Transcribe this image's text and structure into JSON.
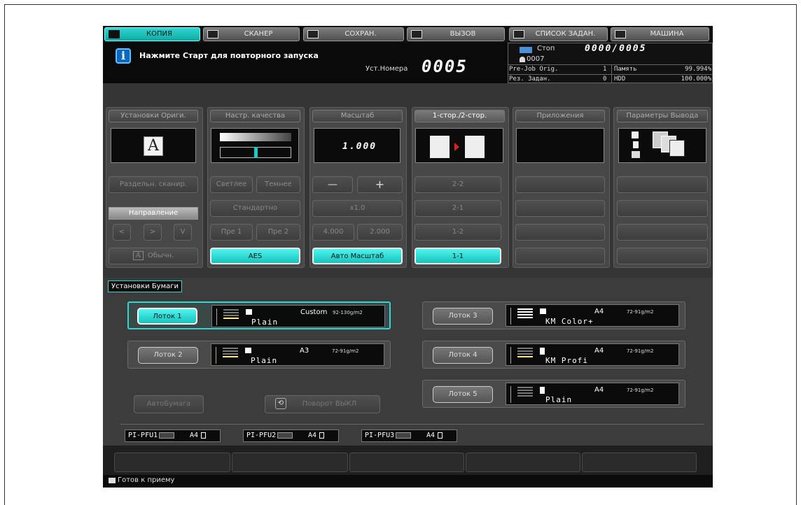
{
  "tabs": [
    {
      "label": "КОПИЯ",
      "icon": "copy-icon"
    },
    {
      "label": "СКАНЕР",
      "icon": "scanner-icon"
    },
    {
      "label": "СОХРАН.",
      "icon": "save-icon"
    },
    {
      "label": "ВЫЗОВ",
      "icon": "recall-icon"
    },
    {
      "label": "СПИСОК ЗАДАН.",
      "icon": "job-list-icon"
    },
    {
      "label": "МАШИНА",
      "icon": "machine-icon"
    }
  ],
  "header": {
    "message": "Нажмите Старт для повторного запуска",
    "set_number_label": "Уст.Номера",
    "set_number": "0005",
    "status_label": "Стоп",
    "counter": "0000/0005",
    "user_id": "0007",
    "prejob_label": "Pre-Job Orig.",
    "prejob_value": "1",
    "memory_label": "Память",
    "memory_value": "99.994%",
    "reserve_label": "Рез. Задан.",
    "reserve_value": "0",
    "hdd_label": "HDD",
    "hdd_value": "100.000%"
  },
  "panels": {
    "original": {
      "title": "Установки Ориги.",
      "separate_scan": "Раздельн. сканир.",
      "direction": "Направление",
      "normal": "Обычн.",
      "display_letter": "A"
    },
    "quality": {
      "title": "Настр. качества",
      "lighter": "Светлее",
      "darker": "Темнее",
      "standard": "Стандартно",
      "pre1": "Пре 1",
      "pre2": "Пре 2",
      "aes": "AES"
    },
    "zoom": {
      "title": "Масштаб",
      "value": "1.000",
      "minus": "—",
      "plus": "+",
      "x1": "x1.0",
      "z4": "4.000",
      "z2": "2.000",
      "auto": "Авто Масштаб"
    },
    "duplex": {
      "title": "1-стор./2-стор.",
      "o22": "2-2",
      "o21": "2-1",
      "o12": "1-2",
      "o11": "1-1"
    },
    "apps": {
      "title": "Приложения"
    },
    "output": {
      "title": "Параметры Вывода"
    }
  },
  "paper": {
    "title": "Установки Бумаги",
    "trays": [
      {
        "label": "Лоток 1",
        "size": "Custom",
        "weight": "92-130g/m2",
        "type": "Plain"
      },
      {
        "label": "Лоток 2",
        "size": "A3",
        "weight": "72-91g/m2",
        "type": "Plain"
      },
      {
        "label": "Лоток 3",
        "size": "A4",
        "weight": "72-91g/m2",
        "type": "KM Color+"
      },
      {
        "label": "Лоток 4",
        "size": "A4",
        "weight": "72-91g/m2",
        "type": "KM Profi"
      },
      {
        "label": "Лоток 5",
        "size": "A4",
        "weight": "72-91g/m2",
        "type": "Plain"
      }
    ],
    "auto_paper": "АвтоБумага",
    "rotation": "Поворот ВЫКЛ",
    "pfu": [
      {
        "name": "PI-PFU1",
        "size": "A4"
      },
      {
        "name": "PI-PFU2",
        "size": "A4"
      },
      {
        "name": "PI-PFU3",
        "size": "A4"
      }
    ]
  },
  "status_bar": {
    "text": "Готов к приему"
  },
  "colors": {
    "accent": "#1ec8c1",
    "info": "#0c67c0"
  }
}
